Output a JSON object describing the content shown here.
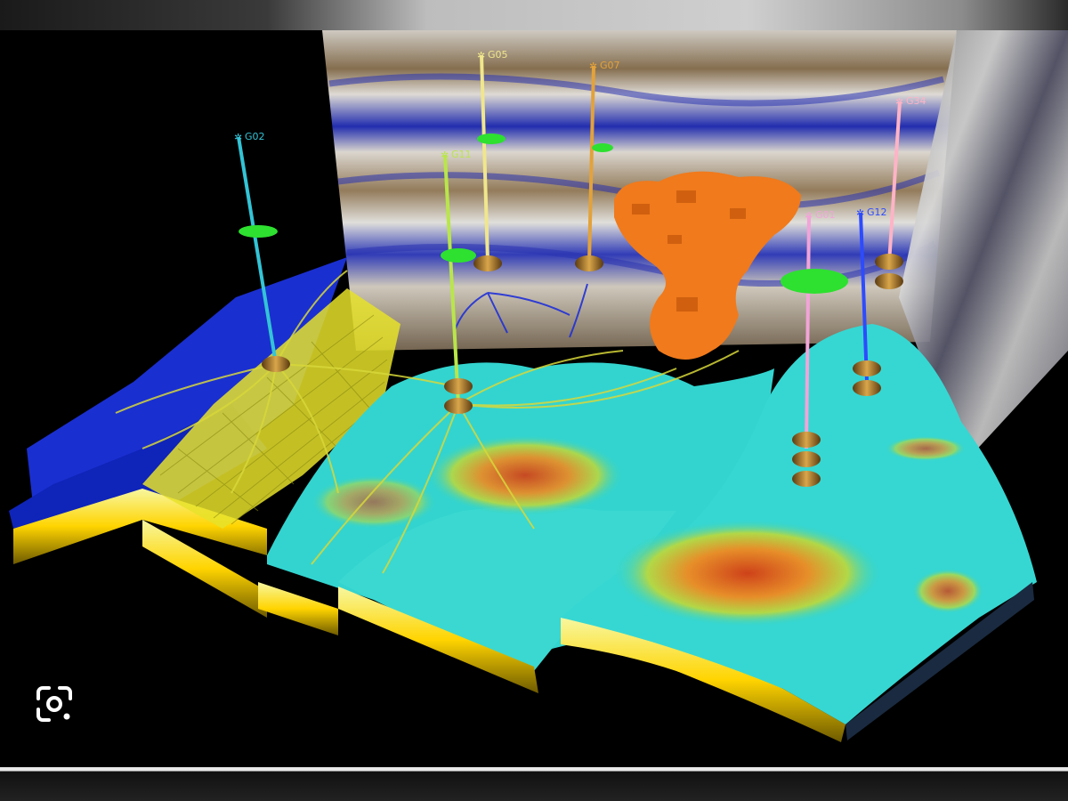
{
  "scene": {
    "description_kind": "3d-reservoir-model",
    "wells": [
      {
        "label": "G02",
        "color": "#33c4d6"
      },
      {
        "label": "G05",
        "color": "#f0e68c"
      },
      {
        "label": "G07",
        "color": "#e3a23a"
      },
      {
        "label": "G11",
        "color": "#b9e64a"
      },
      {
        "label": "G01",
        "color": "#f2a4d8"
      },
      {
        "label": "G12",
        "color": "#2d4bff"
      },
      {
        "label": "G34",
        "color": "#ffb3c6"
      }
    ]
  },
  "toolbar": {
    "lens_icon": "google-lens-icon"
  }
}
